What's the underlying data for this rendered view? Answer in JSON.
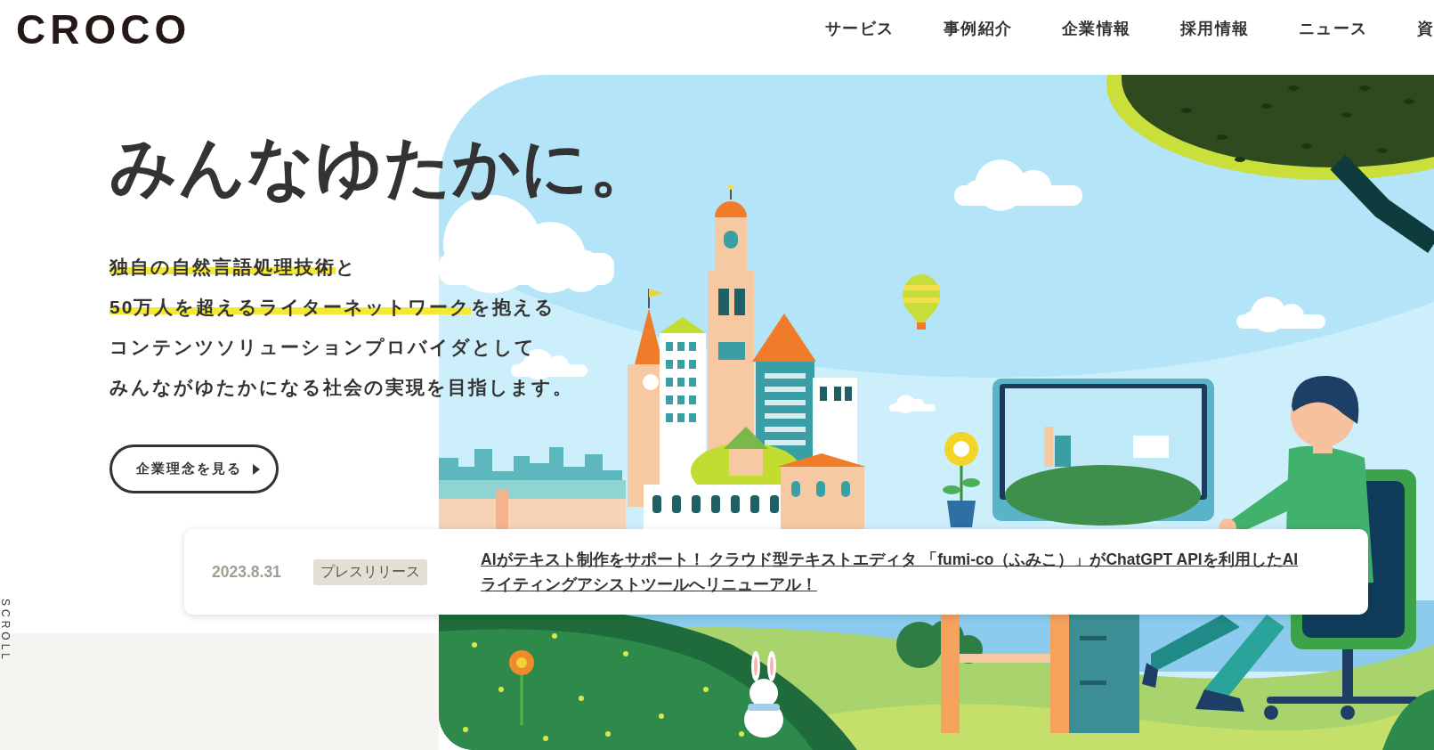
{
  "header": {
    "logo": "CROCO",
    "nav": [
      "サービス",
      "事例紹介",
      "企業情報",
      "採用情報",
      "ニュース",
      "資"
    ]
  },
  "hero": {
    "headline": "みんなゆたかに。",
    "lines": [
      {
        "segments": [
          {
            "text": "独自の自然言語処理技術",
            "highlighted": true
          },
          {
            "text": "と",
            "highlighted": false
          }
        ]
      },
      {
        "segments": [
          {
            "text": "50万人を超えるライターネットワーク",
            "highlighted": true
          },
          {
            "text": "を抱える",
            "highlighted": false
          }
        ]
      },
      {
        "segments": [
          {
            "text": "コンテンツソリューションプロバイダとして",
            "highlighted": false
          }
        ]
      },
      {
        "segments": [
          {
            "text": "みんながゆたかになる社会の実現を目指します。",
            "highlighted": false
          }
        ]
      }
    ],
    "button": "企業理念を見る"
  },
  "news": {
    "date": "2023.8.31",
    "category": "プレスリリース",
    "title": "AIがテキスト制作をサポート！ クラウド型テキストエディタ 「fumi-co（ふみこ）」がChatGPT APIを利用したAIライティングアシストツールへリニューアル！"
  },
  "scroll_label": "SCROLL"
}
